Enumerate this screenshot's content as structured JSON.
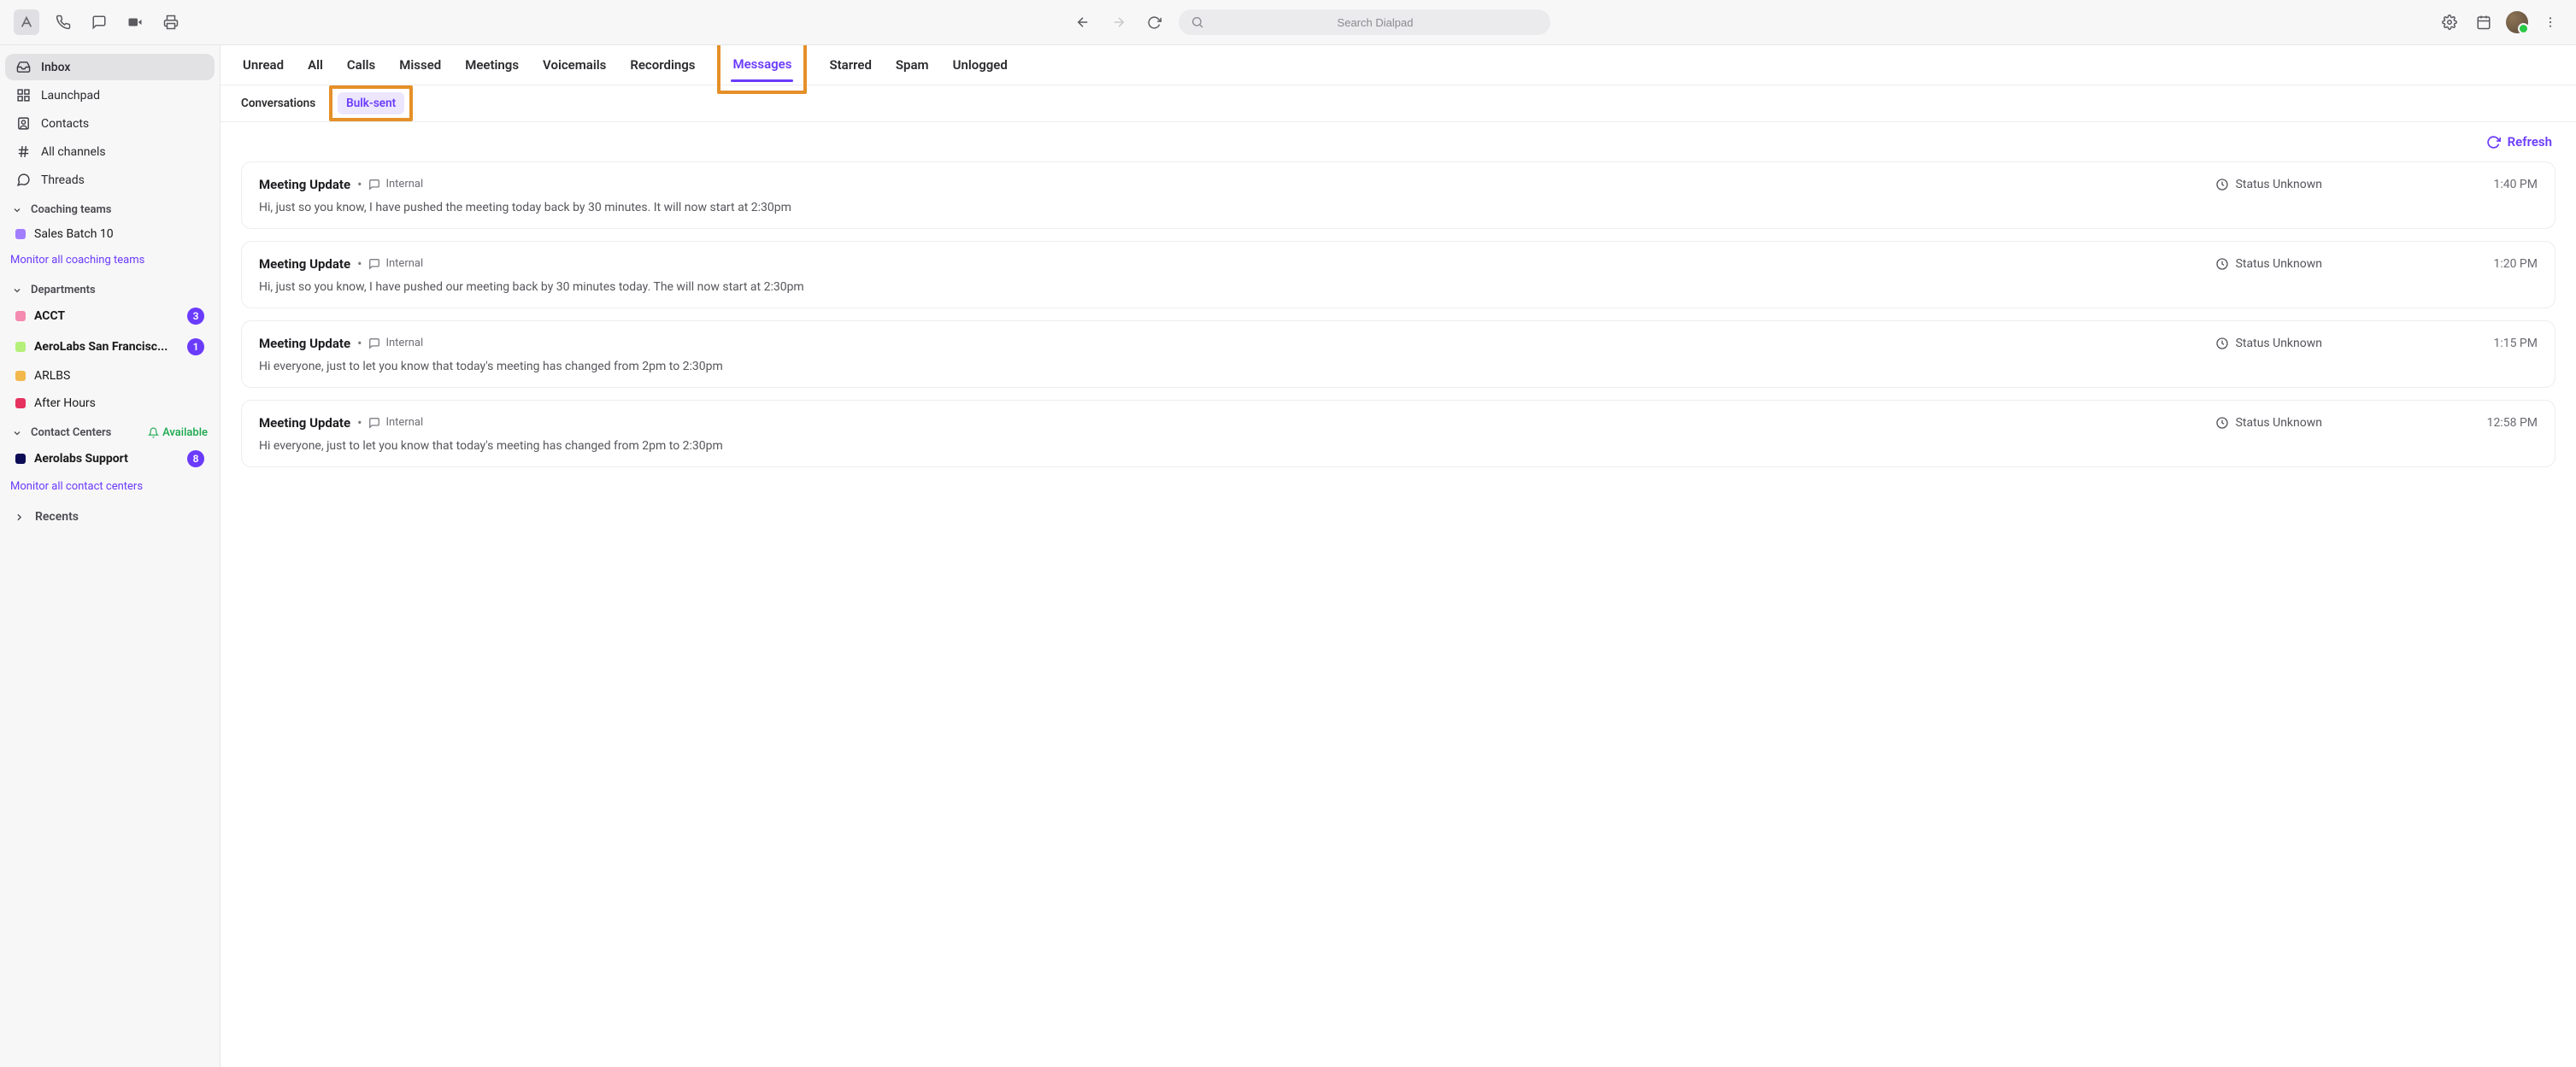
{
  "search": {
    "placeholder": "Search Dialpad"
  },
  "sidebar": {
    "nav": {
      "inbox": "Inbox",
      "launchpad": "Launchpad",
      "contacts": "Contacts",
      "allchannels": "All channels",
      "threads": "Threads"
    },
    "coaching": {
      "header": "Coaching teams",
      "items": [
        {
          "label": "Sales Batch 10",
          "color": "#a27dff"
        }
      ],
      "monitor_link": "Monitor all coaching teams"
    },
    "departments": {
      "header": "Departments",
      "items": [
        {
          "label": "ACCT",
          "color": "#f48bb0",
          "bold": true,
          "count": "3"
        },
        {
          "label": "AeroLabs San Francisc...",
          "color": "#b4f07a",
          "bold": true,
          "count": "1"
        },
        {
          "label": "ARLBS",
          "color": "#f2b84b",
          "bold": false,
          "count": ""
        },
        {
          "label": "After Hours",
          "color": "#e6325f",
          "bold": false,
          "count": ""
        }
      ]
    },
    "contactcenters": {
      "header": "Contact Centers",
      "available": "Available",
      "items": [
        {
          "label": "Aerolabs Support",
          "color": "#0b0b56",
          "bold": true,
          "count": "8"
        }
      ],
      "monitor_link": "Monitor all contact centers"
    },
    "recents": "Recents"
  },
  "tabs": [
    "Unread",
    "All",
    "Calls",
    "Missed",
    "Meetings",
    "Voicemails",
    "Recordings",
    "Messages",
    "Starred",
    "Spam",
    "Unlogged"
  ],
  "active_tab_index": 7,
  "subtabs": {
    "conversations": "Conversations",
    "bulk": "Bulk-sent"
  },
  "refresh_label": "Refresh",
  "status_label": "Status Unknown",
  "internal_label": "Internal",
  "messages": [
    {
      "title": "Meeting Update",
      "body": "Hi, just so you know, I have pushed the meeting today back by 30 minutes. It will now start at 2:30pm",
      "time": "1:40 PM"
    },
    {
      "title": "Meeting Update",
      "body": "Hi, just so you know, I have pushed our meeting back by 30 minutes today. The will now start at 2:30pm",
      "time": "1:20 PM"
    },
    {
      "title": "Meeting Update",
      "body": "Hi everyone, just to let you know that today's meeting has changed from 2pm to 2:30pm",
      "time": "1:15 PM"
    },
    {
      "title": "Meeting Update",
      "body": "Hi everyone, just to let you know that today's meeting has changed from 2pm to 2:30pm",
      "time": "12:58 PM"
    }
  ]
}
